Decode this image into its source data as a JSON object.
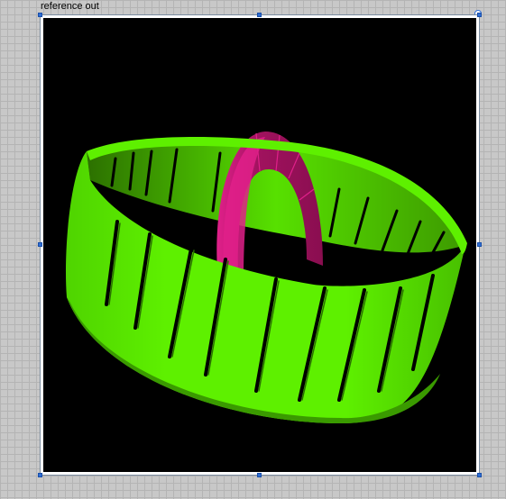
{
  "control": {
    "label": "reference out"
  },
  "scene": {
    "background": "#000000",
    "ring_color": "#5ef000",
    "ring_shadow_color": "#3a8f00",
    "hoop_color": "#a0125e",
    "hoop_highlight_color": "#e0208a"
  },
  "handles": {
    "color": "#2f6fd6",
    "icon": "resize-handle-icon"
  }
}
